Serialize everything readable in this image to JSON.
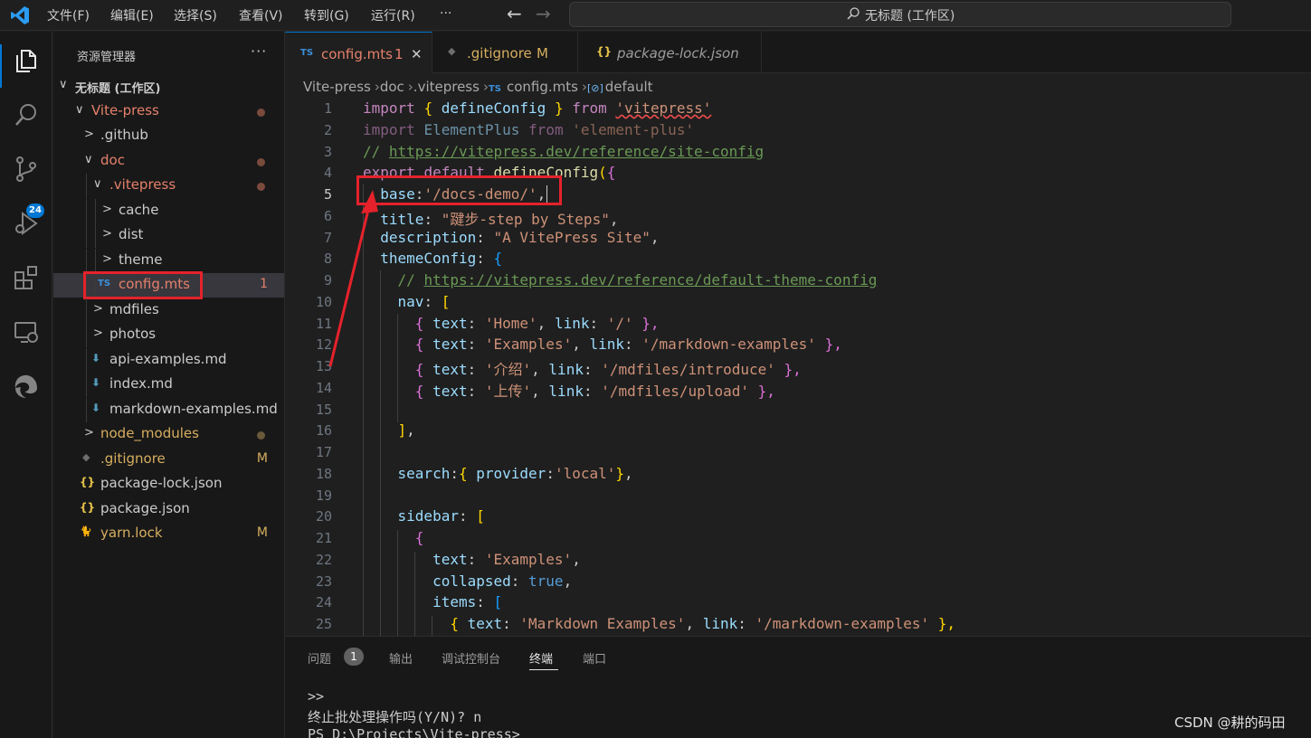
{
  "titlebar": {
    "menus": [
      "文件(F)",
      "编辑(E)",
      "选择(S)",
      "查看(V)",
      "转到(G)",
      "运行(R)",
      "···"
    ],
    "back": "←",
    "forward": "→",
    "command_center": "无标题 (工作区)"
  },
  "activity": {
    "scm_badge": "24"
  },
  "sidebar": {
    "title": "资源管理器",
    "more": "···",
    "tree": [
      {
        "label": "无标题 (工作区)",
        "chevron": "∨",
        "color": "#cccccc"
      },
      {
        "label": "Vite-press",
        "chevron": "∨",
        "color": "#e5806b"
      },
      {
        "label": ".github",
        "chevron": ">",
        "color": "#cccccc"
      },
      {
        "label": "doc",
        "chevron": "∨",
        "color": "#e5806b"
      },
      {
        "label": ".vitepress",
        "chevron": "∨",
        "color": "#e5806b"
      },
      {
        "label": "cache",
        "chevron": ">",
        "color": "#cccccc"
      },
      {
        "label": "dist",
        "chevron": ">",
        "color": "#cccccc"
      },
      {
        "label": "theme",
        "chevron": ">",
        "color": "#cccccc"
      },
      {
        "label": "config.mts",
        "icon": "TS",
        "decoration": "1",
        "color": "#e5806b"
      },
      {
        "label": "mdfiles",
        "chevron": ">",
        "color": "#cccccc"
      },
      {
        "label": "photos",
        "chevron": ">",
        "color": "#cccccc"
      },
      {
        "label": "api-examples.md",
        "icon": "⬇",
        "color": "#cccccc"
      },
      {
        "label": "index.md",
        "icon": "⬇",
        "color": "#cccccc"
      },
      {
        "label": "markdown-examples.md",
        "icon": "⬇",
        "color": "#cccccc"
      },
      {
        "label": "node_modules",
        "chevron": ">",
        "color": "#d6ae5f"
      },
      {
        "label": ".gitignore",
        "icon": "◆",
        "decoration": "M",
        "color": "#d6ae5f"
      },
      {
        "label": "package-lock.json",
        "icon": "{}",
        "color": "#cccccc"
      },
      {
        "label": "package.json",
        "icon": "{}",
        "color": "#cccccc"
      },
      {
        "label": "yarn.lock",
        "icon": "🐈",
        "decoration": "M",
        "color": "#d6ae5f"
      }
    ]
  },
  "tabs": [
    {
      "icon": "TS",
      "label": "config.mts",
      "badge": "1",
      "close": "✕"
    },
    {
      "icon": "◆",
      "label": ".gitignore",
      "badge": "M"
    },
    {
      "icon": "{}",
      "label": "package-lock.json"
    }
  ],
  "breadcrumb": [
    "Vite-press",
    "doc",
    ".vitepress",
    "config.mts",
    "default"
  ],
  "breadcrumb_icons": {
    "ts": "TS",
    "symbol": "[⊘]"
  },
  "editor": {
    "line_numbers": [
      "1",
      "2",
      "3",
      "4",
      "5",
      "6",
      "7",
      "8",
      "9",
      "10",
      "11",
      "12",
      "13",
      "14",
      "15",
      "16",
      "17",
      "18",
      "19",
      "20",
      "21",
      "22",
      "23",
      "24",
      "25"
    ],
    "current_line": "5",
    "code": {
      "l1": [
        "import",
        "{",
        "defineConfig",
        "}",
        "from",
        "'vitepress'"
      ],
      "l2": [
        "import",
        "ElementPlus",
        "from",
        "'element-plus'"
      ],
      "l3": [
        "// ",
        "https://vitepress.dev/reference/site-config"
      ],
      "l4": [
        "export",
        "default",
        "defineConfig",
        "(",
        "{"
      ],
      "l5": [
        "base",
        ":",
        "'/docs-demo/'",
        ","
      ],
      "l6": [
        "title",
        ": ",
        "\"踺步-step by Steps\"",
        ","
      ],
      "l7": [
        "description",
        ": ",
        "\"A VitePress Site\"",
        ","
      ],
      "l8": [
        "themeConfig",
        ": ",
        "{"
      ],
      "l9": [
        "// ",
        "https://vitepress.dev/reference/default-theme-config"
      ],
      "l10": [
        "nav",
        ": ",
        "["
      ],
      "l11": [
        "{",
        "text",
        ": ",
        "'Home'",
        ", ",
        "link",
        ": ",
        "'/'",
        "},"
      ],
      "l12": [
        "{",
        "text",
        ": ",
        "'Examples'",
        ", ",
        "link",
        ": ",
        "'/markdown-examples'",
        "},"
      ],
      "l13": [
        "{",
        "text",
        ": ",
        "'介绍'",
        ", ",
        "link",
        ": ",
        "'/mdfiles/introduce'",
        "},"
      ],
      "l14": [
        "{",
        "text",
        ": ",
        "'上传'",
        ", ",
        "link",
        ": ",
        "'/mdfiles/upload'",
        "},"
      ],
      "l16": [
        "]",
        ","
      ],
      "l18": [
        "search",
        ":",
        "{",
        " provider",
        ":",
        "'local'",
        "}",
        ","
      ],
      "l20": [
        "sidebar",
        ": ",
        "["
      ],
      "l21": [
        "{"
      ],
      "l22": [
        "text",
        ": ",
        "'Examples'",
        ","
      ],
      "l23": [
        "collapsed",
        ": ",
        "true",
        ","
      ],
      "l24": [
        "items",
        ": ",
        "["
      ],
      "l25": [
        "{",
        "text",
        ": ",
        "'Markdown Examples'",
        ", ",
        "link",
        ": ",
        "'/markdown-examples'",
        "},"
      ]
    }
  },
  "panel": {
    "tabs": [
      "问题",
      "输出",
      "调试控制台",
      "终端",
      "端口"
    ],
    "problems_count": "1",
    "active_tab": "终端",
    "terminal": [
      ">>",
      "终止批处理操作吗(Y/N)? n",
      "PS D:\\Projects\\Vite-press>"
    ]
  },
  "watermark": "CSDN @耕的码田",
  "colors": {
    "accent": "#0078d4",
    "annotation_red": "#e5222b",
    "modified": "#d6ae5f",
    "error": "#e5806b"
  }
}
